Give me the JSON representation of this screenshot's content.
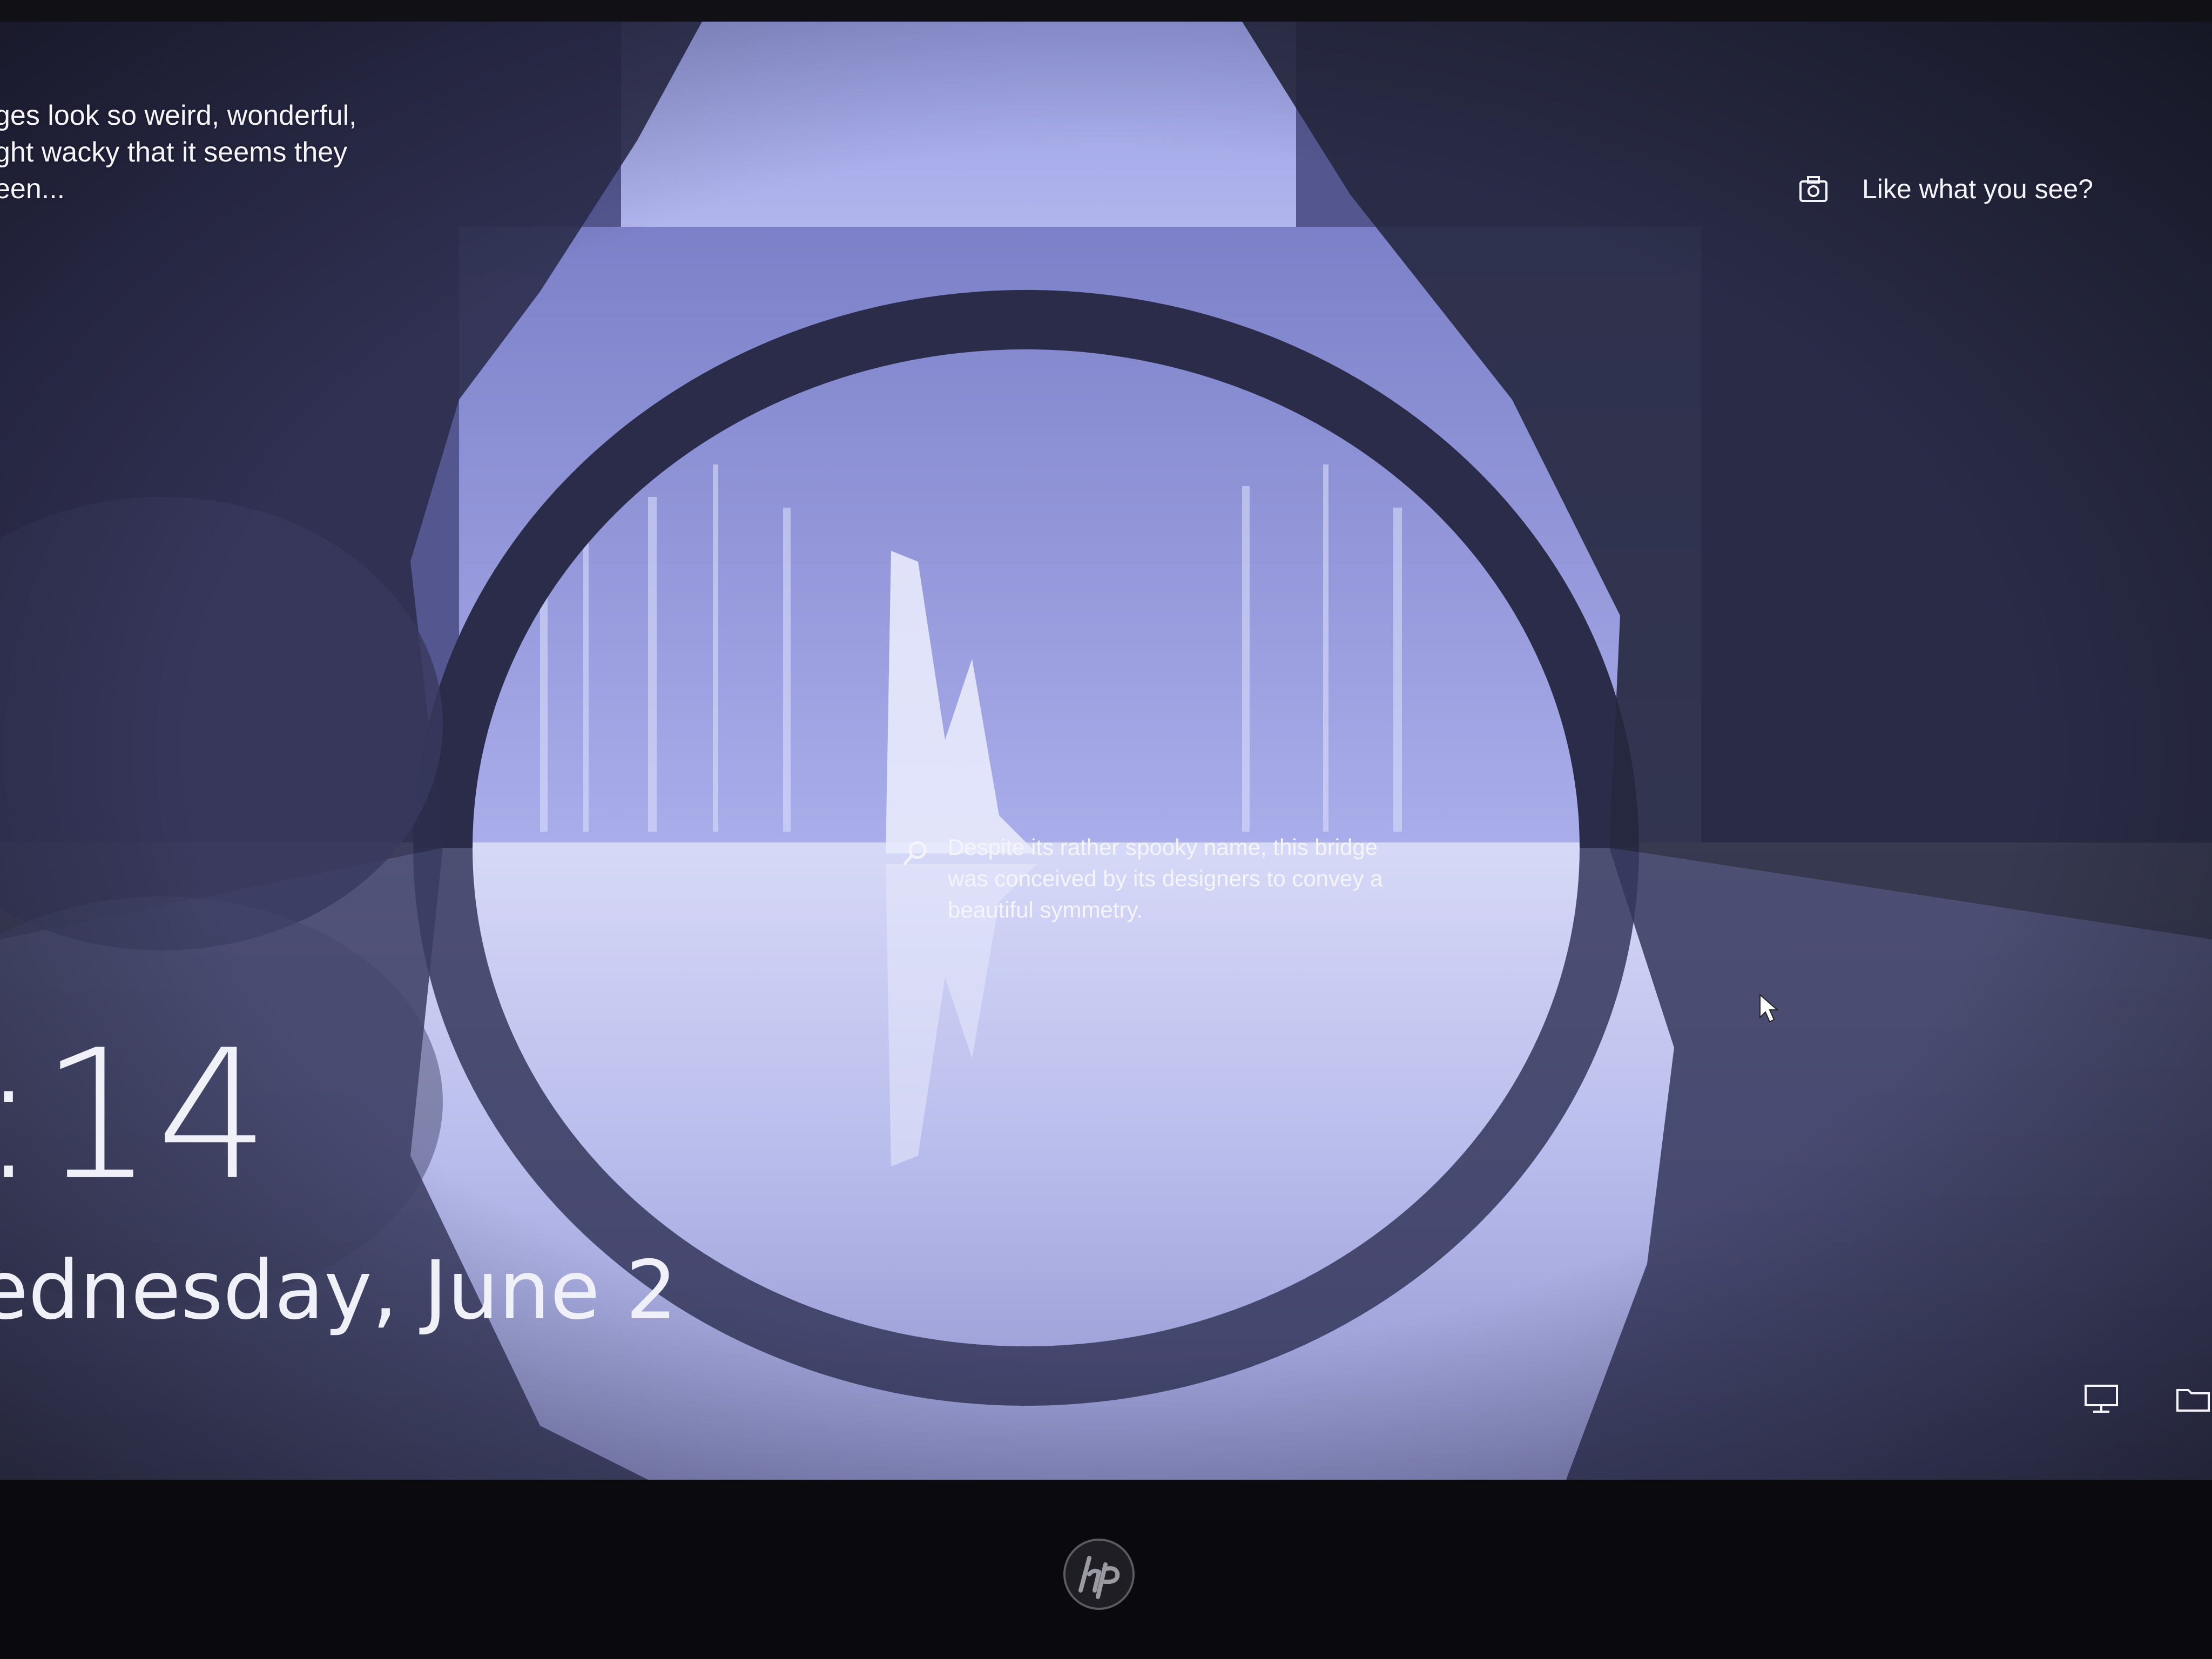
{
  "lockscreen": {
    "caption_lines": [
      "ges look so weird, wonderful,",
      "ght wacky that it seems they",
      "een..."
    ],
    "like_label": "Like what you see?",
    "clock": ":14",
    "date": "ednesday, June 2",
    "spotlight_text": "Despite its rather spooky name, this bridge was conceived by its designers to convey a beautiful symmetry."
  },
  "icons": {
    "camera": "camera-icon",
    "spotlight": "search-icon",
    "cursor": "mouse-cursor-icon",
    "network": "network-icon",
    "folder": "folder-icon",
    "brand": "hp-logo"
  },
  "colors": {
    "sky": "#9aa0e0",
    "water": "#c8ccf4",
    "foliage": "#2a2c4a",
    "text": "#f4f4fa"
  }
}
